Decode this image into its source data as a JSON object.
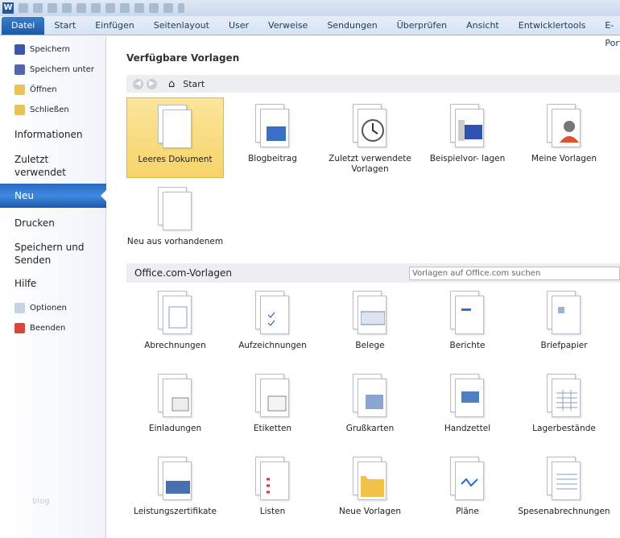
{
  "app": {
    "logo": "W"
  },
  "tabs": [
    "Datei",
    "Start",
    "Einfügen",
    "Seitenlayout",
    "User",
    "Verweise",
    "Sendungen",
    "Überprüfen",
    "Ansicht",
    "Entwicklertools",
    "E-Porto"
  ],
  "sidebar": {
    "speichern": "Speichern",
    "speichern_unter": "Speichern unter",
    "oeffnen": "Öffnen",
    "schliessen": "Schließen",
    "informationen": "Informationen",
    "zuletzt": "Zuletzt verwendet",
    "neu": "Neu",
    "drucken": "Drucken",
    "speichern_senden": "Speichern und Senden",
    "hilfe": "Hilfe",
    "optionen": "Optionen",
    "beenden": "Beenden",
    "watermark": "blog"
  },
  "main": {
    "heading": "Verfügbare Vorlagen",
    "nav_home": "Start",
    "available": [
      "Leeres Dokument",
      "Blogbeitrag",
      "Zuletzt verwendete Vorlagen",
      "Beispielvor- lagen",
      "Meine Vorlagen",
      "Neu aus vorhandenem"
    ],
    "office_heading": "Office.com-Vorlagen",
    "search_placeholder": "Vorlagen auf Office.com suchen",
    "office": [
      "Abrechnungen",
      "Aufzeichnungen",
      "Belege",
      "Berichte",
      "Briefpapier",
      "Einladungen",
      "Etiketten",
      "Grußkarten",
      "Handzettel",
      "Lagerbestände",
      "Leistungszertifikate",
      "Listen",
      "Neue Vorlagen",
      "Pläne",
      "Spesenabrechnungen"
    ]
  },
  "colors": {
    "accent": "#2a6ac0",
    "selected": "#f7d46a"
  }
}
